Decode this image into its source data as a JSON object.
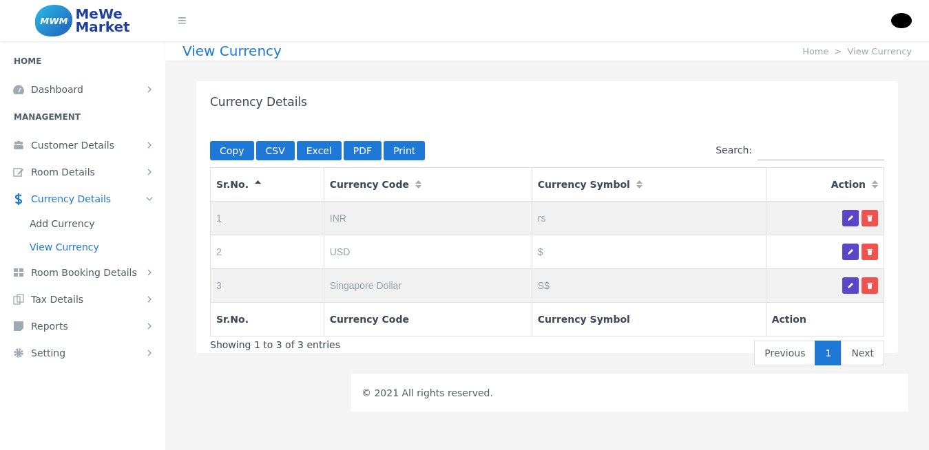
{
  "header": {
    "logo_mark": "MWM",
    "logo_text": [
      "MeWe",
      "Market"
    ],
    "menu_glyph": "≡"
  },
  "page_header": {
    "title": "View Currency",
    "breadcrumb": [
      {
        "label": "Home"
      },
      {
        "label": "View Currency"
      }
    ],
    "separator": ">"
  },
  "sidebar": [
    {
      "kind": "section",
      "label": "HOME"
    },
    {
      "kind": "item",
      "label": "Dashboard",
      "selected": false,
      "expanded": false
    },
    {
      "kind": "section",
      "label": "MANAGEMENT"
    },
    {
      "kind": "item",
      "label": "Customer Details",
      "selected": false,
      "expanded": false
    },
    {
      "kind": "item",
      "label": "Room Details",
      "selected": false,
      "expanded": false
    },
    {
      "kind": "item",
      "label": "Currency Details",
      "selected": true,
      "expanded": true,
      "children": [
        {
          "label": "Add Currency",
          "selected": false
        },
        {
          "label": "View Currency",
          "selected": true
        }
      ]
    },
    {
      "kind": "item",
      "label": "Room Booking Details",
      "selected": false,
      "expanded": false
    },
    {
      "kind": "item",
      "label": "Tax Details",
      "selected": false,
      "expanded": false
    },
    {
      "kind": "item",
      "label": "Reports",
      "selected": false,
      "expanded": false
    },
    {
      "kind": "item",
      "label": "Setting",
      "selected": false,
      "expanded": false
    }
  ],
  "card": {
    "title": "Currency Details",
    "export_buttons": [
      "Copy",
      "CSV",
      "Excel",
      "PDF",
      "Print"
    ],
    "search": {
      "label": "Search:"
    },
    "table": {
      "columns": [
        {
          "label": "Sr.No.",
          "sorted": true
        },
        {
          "label": "Currency Code",
          "sorted": false
        },
        {
          "label": "Currency Symbol",
          "sorted": false
        },
        {
          "label": "Action",
          "sorted": false
        }
      ],
      "rows": [
        [
          "1",
          "INR",
          "rs"
        ],
        [
          "2",
          "USD",
          "$"
        ],
        [
          "3",
          "Singapore Dollar",
          "S$"
        ]
      ],
      "footer": [
        "Sr.No.",
        "Currency Code",
        "Currency Symbol",
        "Action"
      ]
    },
    "info": "Showing 1 to 3 of 3 entries",
    "pagination": [
      {
        "label": "Previous",
        "selected": false
      },
      {
        "label": "1",
        "selected": true
      },
      {
        "label": "Next",
        "selected": false
      }
    ]
  },
  "footer": {
    "text": "© 2021 All rights reserved."
  }
}
